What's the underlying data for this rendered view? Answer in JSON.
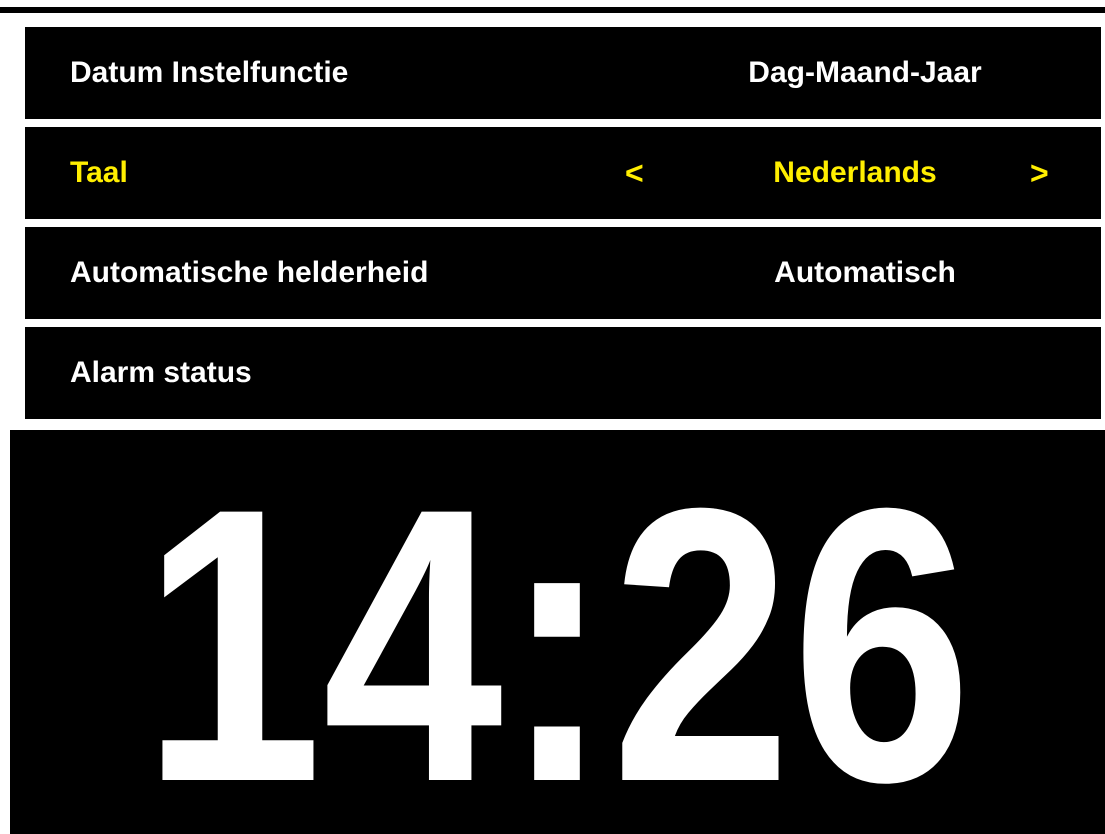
{
  "settings": {
    "rows": [
      {
        "label": "Datum Instelfunctie",
        "value": "Dag-Maand-Jaar",
        "selected": false
      },
      {
        "label": "Taal",
        "value": "Nederlands",
        "selected": true,
        "prev": "<",
        "next": ">"
      },
      {
        "label": "Automatische helderheid",
        "value": "Automatisch",
        "selected": false
      },
      {
        "label": "Alarm status",
        "value": "",
        "selected": false
      }
    ]
  },
  "clock": {
    "time": "14:26"
  },
  "colors": {
    "background": "#000000",
    "text": "#ffffff",
    "selected": "#ffee00"
  }
}
